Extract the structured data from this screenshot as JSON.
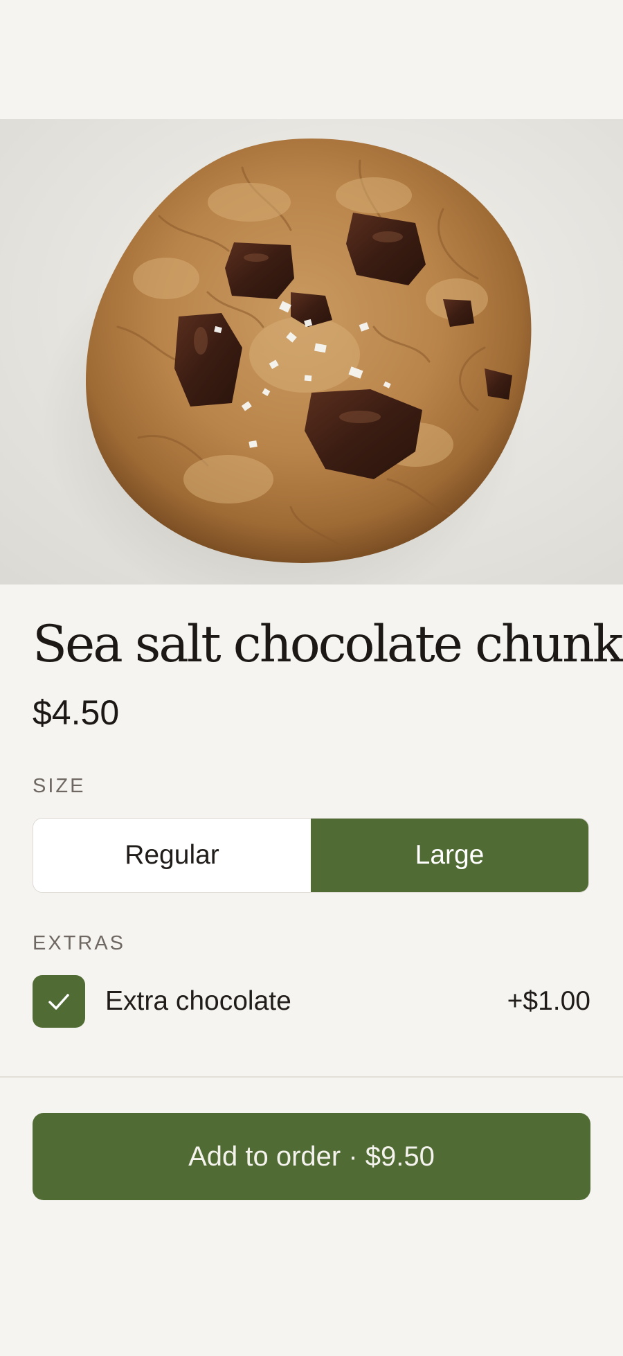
{
  "product": {
    "title": "Sea salt chocolate chunk",
    "price": "$4.50",
    "image_subject": "chocolate-chunk-cookie-photo"
  },
  "size": {
    "label": "SIZE",
    "options": [
      "Regular",
      "Large"
    ],
    "selected": "Large"
  },
  "extras": {
    "label": "EXTRAS",
    "items": [
      {
        "name": "Extra chocolate",
        "price": "+$1.00",
        "checked": true
      }
    ]
  },
  "cta": {
    "label": "Add to order · $9.50"
  },
  "colors": {
    "accent": "#506b33",
    "background": "#f6f4f1",
    "text": "#1b1815",
    "muted_label": "#6f6862"
  },
  "icons": {
    "checkbox": "check-icon"
  }
}
